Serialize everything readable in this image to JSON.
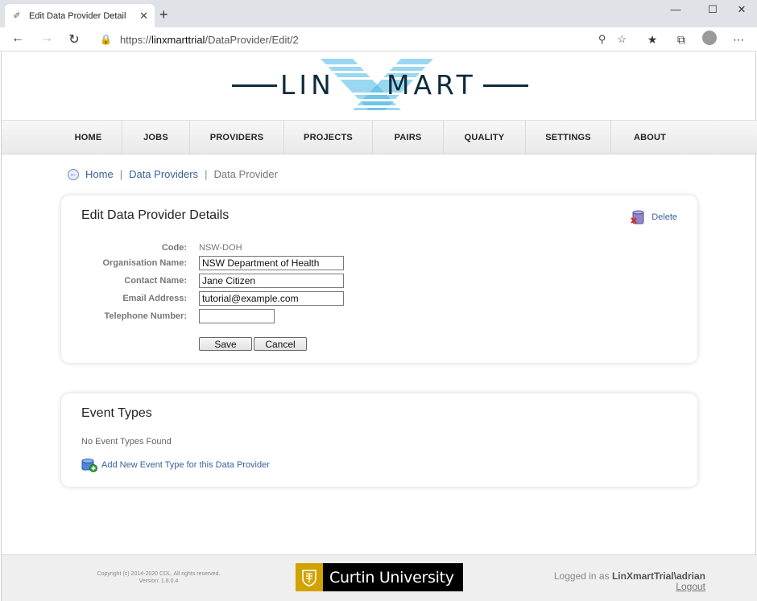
{
  "browser": {
    "tab_title": "Edit Data Provider Detail",
    "url_prefix": "https://",
    "url_host": "linxmarttrial",
    "url_path": "/DataProvider/Edit/2"
  },
  "header": {
    "logo_text_left": "LIN",
    "logo_text_right": "MART"
  },
  "menu": {
    "items": [
      "HOME",
      "JOBS",
      "PROVIDERS",
      "PROJECTS",
      "PAIRS",
      "QUALITY",
      "SETTINGS",
      "ABOUT"
    ]
  },
  "breadcrumb": {
    "home": "Home",
    "separator": "|",
    "providers": "Data Providers",
    "current": "Data Provider"
  },
  "details": {
    "title": "Edit Data Provider Details",
    "delete_label": "Delete",
    "code_label": "Code:",
    "code_value": "NSW-DOH",
    "org_label": "Organisation Name:",
    "org_value": "NSW Department of Health",
    "contact_label": "Contact Name:",
    "contact_value": "Jane Citizen",
    "email_label": "Email Address:",
    "email_value": "tutorial@example.com",
    "phone_label": "Telephone Number:",
    "phone_value": "",
    "save_label": "Save",
    "cancel_label": "Cancel"
  },
  "events": {
    "title": "Event Types",
    "none_found": "No Event Types Found",
    "add_label": "Add New Event Type for this Data Provider"
  },
  "footer": {
    "copyright": "Copyright (c) 2014-2020 CDL. All rights reserved.",
    "version": "Version: 1.8.0.4",
    "university": "Curtin University",
    "logged_in_prefix": "Logged in as",
    "user": "LinXmartTrial\\adrian",
    "logout": "Logout"
  },
  "colors": {
    "link": "#3b5f98",
    "logo_dark": "#0f2b3a",
    "logo_teal": "#0d7d83",
    "logo_blue": "#47b6e6",
    "curtin_gold": "#d1a200"
  }
}
